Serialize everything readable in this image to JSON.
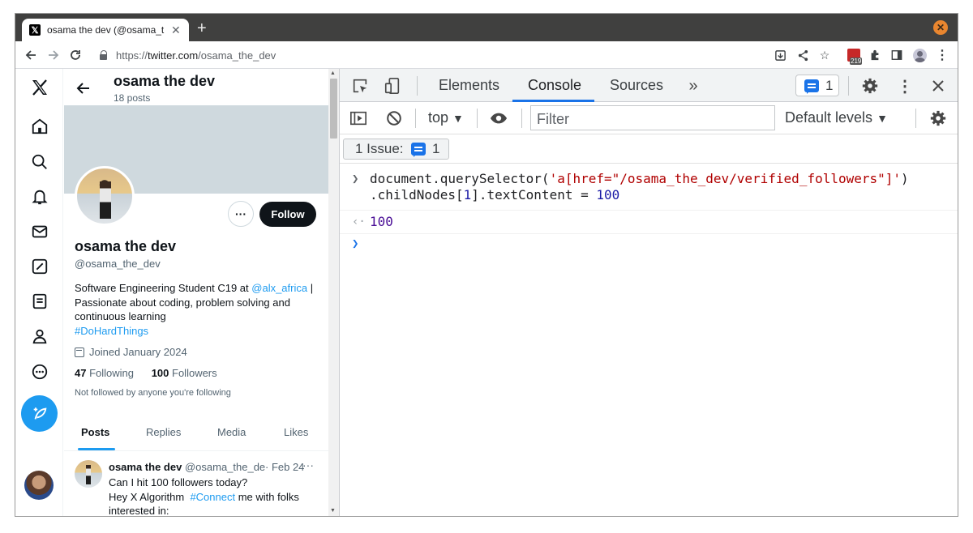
{
  "browser": {
    "tab_title": "osama the dev (@osama_the",
    "url_prefix": "https://",
    "url_host": "twitter.com",
    "url_path": "/osama_the_dev",
    "extension_badge": "219"
  },
  "twitter": {
    "header_name": "osama the dev",
    "header_posts": "18 posts",
    "follow_label": "Follow",
    "name": "osama the dev",
    "handle": "@osama_the_dev",
    "bio_1": "Software Engineering Student C19 at ",
    "bio_link": "@alx_africa",
    "bio_2": " | Passionate about coding, problem solving and continuous learning",
    "bio_hashtag": "#DoHardThings",
    "joined": "Joined January 2024",
    "following_count": "47",
    "following_label": "Following",
    "followers_count": "100",
    "followers_label": "Followers",
    "not_followed": "Not followed by anyone you're following",
    "tabs": [
      "Posts",
      "Replies",
      "Media",
      "Likes"
    ],
    "tweet": {
      "name": "osama the dev",
      "handle": "@osama_the_de",
      "date": "· Feb 24",
      "line1": "Can I hit 100 followers today?",
      "line2_pre": "Hey X Algorithm  ",
      "line2_tag": "#Connect",
      "line2_post": " me with folks",
      "line3": "interested in:"
    }
  },
  "devtools": {
    "tabs": [
      "Elements",
      "Console",
      "Sources"
    ],
    "issue_count": "1",
    "context": "top",
    "filter_placeholder": "Filter",
    "levels": "Default levels",
    "issues_label": "1 Issue:",
    "issues_count": "1",
    "console": {
      "cmd1_a": "document.querySelector(",
      "cmd1_str": "'a[href=\"/osama_the_dev/verified_followers\"]'",
      "cmd1_b": ")",
      "cmd2_a": ".childNodes[",
      "cmd2_idx": "1",
      "cmd2_b": "].textContent = ",
      "cmd2_val": "100",
      "result": "100"
    }
  },
  "colors": {
    "accent": "#1d9bf0",
    "devtools_blue": "#1a73e8",
    "string_red": "#b00000"
  }
}
